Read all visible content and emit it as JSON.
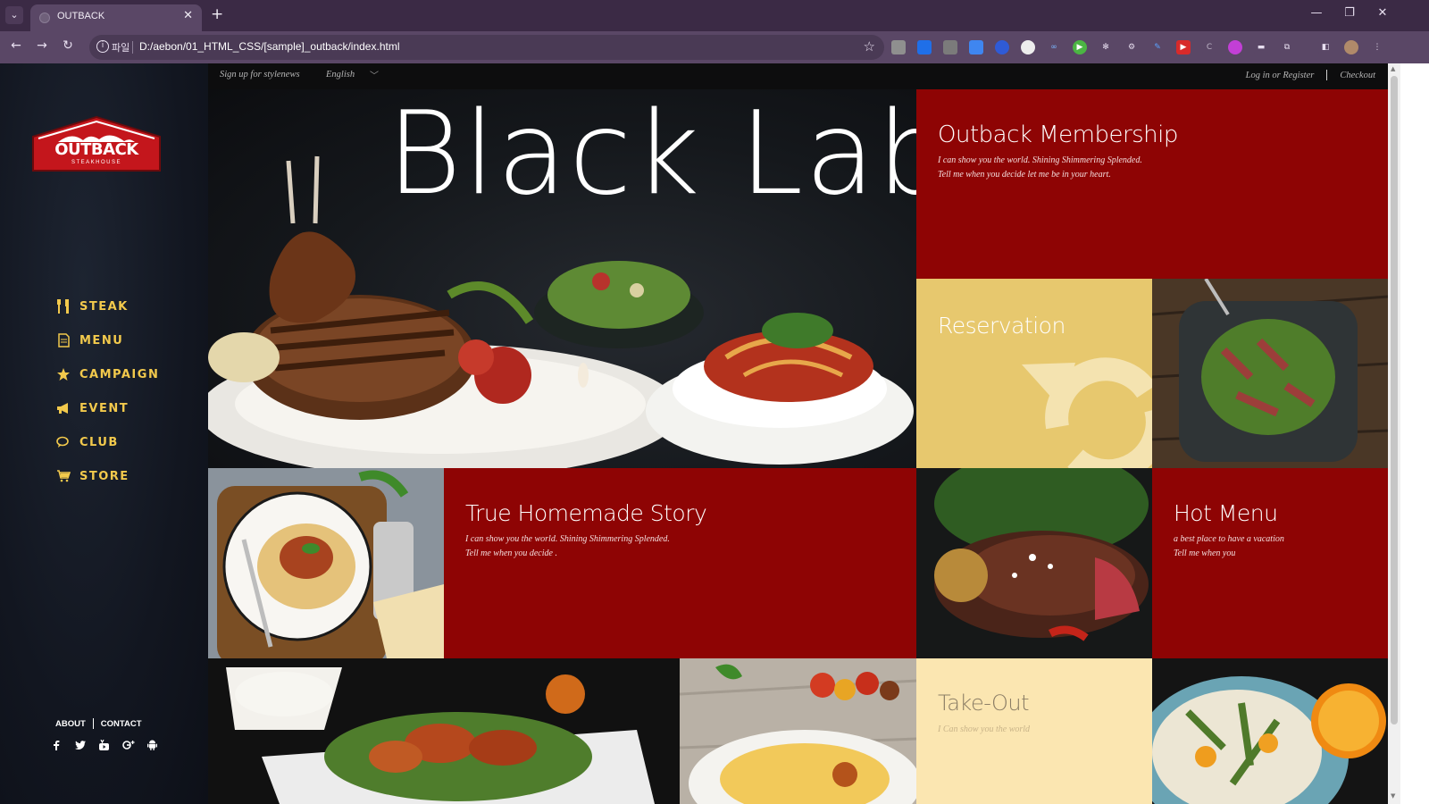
{
  "browser": {
    "tab_title": "OUTBACK",
    "omnibox_scheme": "파일",
    "url": "D:/aebon/01_HTML_CSS/[sample]_outback/index.html"
  },
  "topbar": {
    "newsletter": "Sign up for stylenews",
    "language": "English",
    "login": "Log in or Register",
    "checkout": "Checkout"
  },
  "logo": {
    "wordmark": "OUTBACK",
    "tagline": "STEAKHOUSE"
  },
  "nav": {
    "items": [
      {
        "label": "STEAK",
        "icon": "fork-knife-icon"
      },
      {
        "label": "MENU",
        "icon": "document-icon"
      },
      {
        "label": "CAMPAIGN",
        "icon": "star-icon"
      },
      {
        "label": "EVENT",
        "icon": "megaphone-icon"
      },
      {
        "label": "CLUB",
        "icon": "chat-icon"
      },
      {
        "label": "STORE",
        "icon": "cart-icon"
      }
    ]
  },
  "footer": {
    "about": "ABOUT",
    "contact": "CONTACT",
    "social": [
      "facebook-icon",
      "twitter-icon",
      "youtube-icon",
      "google-plus-icon",
      "android-icon"
    ]
  },
  "hero": {
    "title": "Black Label"
  },
  "tiles": {
    "membership": {
      "title": "Outback Membership",
      "line1": "I can show you the world. Shining Shimmering Splended.",
      "line2": "Tell me when you decide let me be in your heart."
    },
    "reservation": {
      "title": "Reservation"
    },
    "story": {
      "title": "True Homemade Story",
      "line1": "I can show you the world. Shining Shimmering Splended.",
      "line2": "Tell me when you decide ."
    },
    "hotmenu": {
      "title": "Hot Menu",
      "line1": "a best place to have a vacation",
      "line2": "Tell me when you"
    },
    "takeout": {
      "title": "Take-Out",
      "line1": "I Can show you the world"
    }
  },
  "colors": {
    "accent_red": "#8e0404",
    "gold": "#e7c86e",
    "cream": "#fbe6b1",
    "nav_yellow": "#f2c94c"
  }
}
